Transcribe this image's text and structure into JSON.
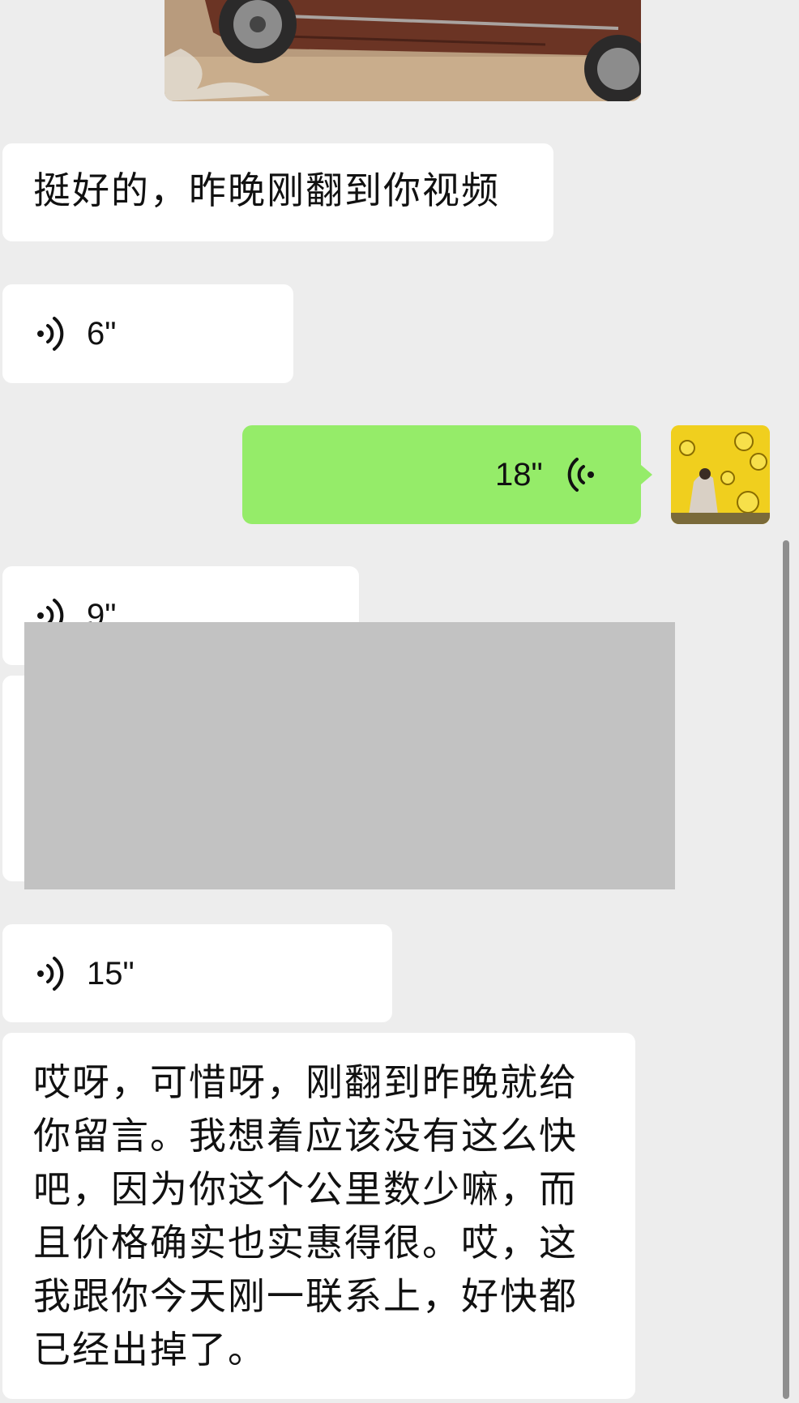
{
  "messages": [
    {
      "type": "image",
      "content": "car-photo",
      "sender": "other"
    },
    {
      "type": "text",
      "sender": "other",
      "text": "挺好的，昨晚刚翻到你视频"
    },
    {
      "type": "voice",
      "sender": "other",
      "duration": "6\""
    },
    {
      "type": "voice",
      "sender": "me",
      "duration": "18\""
    },
    {
      "type": "voice",
      "sender": "other",
      "duration": "9\""
    },
    {
      "type": "voice",
      "sender": "other",
      "duration": "15\""
    },
    {
      "type": "text",
      "sender": "other",
      "lines": [
        "哎呀，可惜呀，刚翻到昨晚就给",
        "你留言。我想着应该没有这么快",
        "吧，因为你这个公里数少嘛，而",
        "且价格确实也实惠得很。哎，这",
        "我跟你今天刚一联系上，好快都",
        "已经出掉了。"
      ]
    }
  ],
  "colors": {
    "background": "#ededed",
    "bubble_other": "#ffffff",
    "bubble_me": "#95ec69",
    "redaction": "#c2c2c2"
  },
  "icons": {
    "voice_other": "voice-wave-icon",
    "voice_me": "voice-wave-icon-mirrored"
  }
}
